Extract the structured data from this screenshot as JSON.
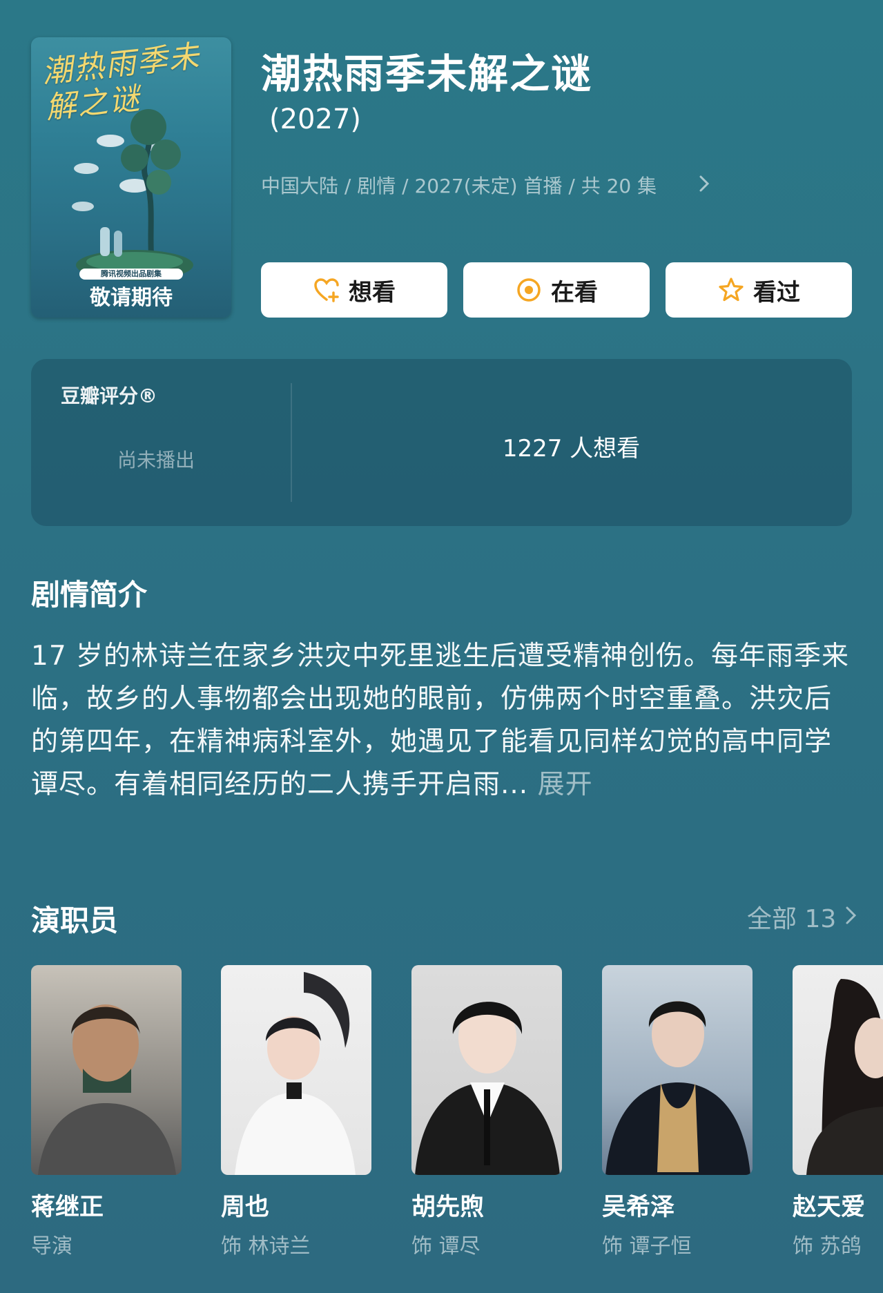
{
  "poster": {
    "title_art": "潮热雨季未解之谜",
    "studio": "腾讯视频出品剧集",
    "tagline": "敬请期待"
  },
  "show": {
    "title": "潮热雨季未解之谜",
    "year": "(2027)",
    "meta": "中国大陆 / 剧情 / 2027(未定) 首播 / 共 20 集"
  },
  "actions": [
    {
      "label": "想看",
      "icon": "heart-plus-icon",
      "color": "#f5a623"
    },
    {
      "label": "在看",
      "icon": "target-circle-icon",
      "color": "#f5a623"
    },
    {
      "label": "看过",
      "icon": "star-outline-icon",
      "color": "#f5a623"
    }
  ],
  "rating": {
    "label": "豆瓣评分®",
    "status": "尚未播出",
    "want_count": "1227 人想看"
  },
  "synopsis": {
    "heading": "剧情简介",
    "text": "17 岁的林诗兰在家乡洪灾中死里逃生后遭受精神创伤。每年雨季来临，故乡的人事物都会出现她的眼前，仿佛两个时空重叠。洪灾后的第四年，在精神病科室外，她遇见了能看见同样幻觉的高中同学谭尽。有着相同经历的二人携手开启雨...",
    "expand": "展开"
  },
  "cast": {
    "heading": "演职员",
    "all_label": "全部 13",
    "members": [
      {
        "name": "蒋继正",
        "role": "导演"
      },
      {
        "name": "周也",
        "role": "饰 林诗兰"
      },
      {
        "name": "胡先煦",
        "role": "饰 谭尽"
      },
      {
        "name": "吴希泽",
        "role": "饰 谭子恒"
      },
      {
        "name": "赵天爱",
        "role": "饰 苏鸽"
      }
    ]
  }
}
